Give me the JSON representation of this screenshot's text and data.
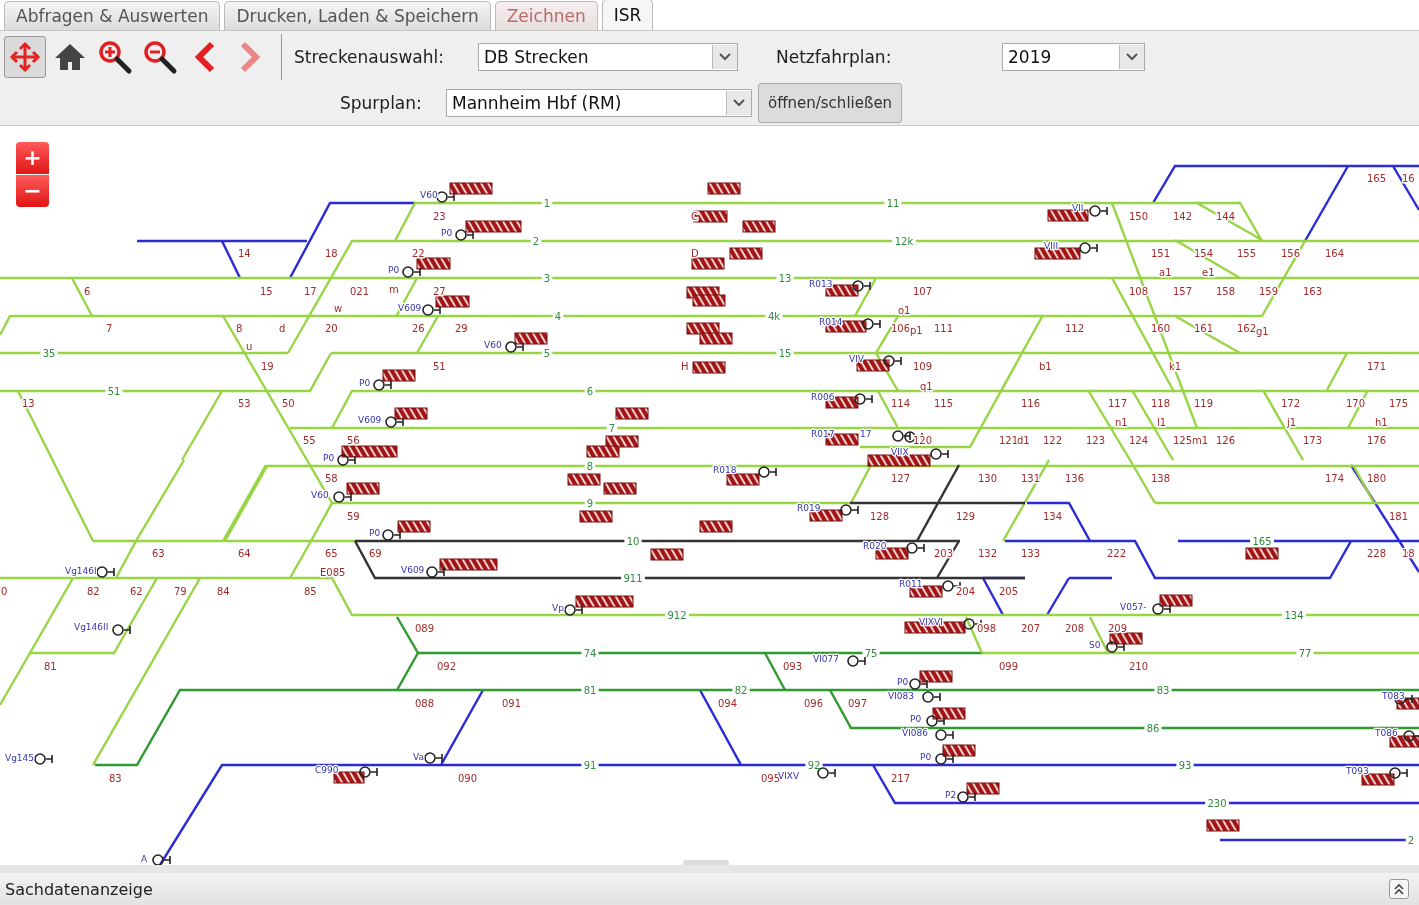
{
  "tabs": [
    {
      "label": "Abfragen & Auswerten",
      "selected": false,
      "disabled": false
    },
    {
      "label": "Drucken, Laden & Speichern",
      "selected": false,
      "disabled": false
    },
    {
      "label": "Zeichnen",
      "selected": false,
      "disabled": true
    },
    {
      "label": "ISR",
      "selected": true,
      "disabled": false
    }
  ],
  "tools": [
    {
      "kind": "pan",
      "selected": true,
      "disabled": false
    },
    {
      "kind": "home",
      "selected": false,
      "disabled": false
    },
    {
      "kind": "zoom_in",
      "selected": false,
      "disabled": false
    },
    {
      "kind": "zoom_out",
      "selected": false,
      "disabled": false
    },
    {
      "kind": "back",
      "selected": false,
      "disabled": false
    },
    {
      "kind": "forward",
      "selected": false,
      "disabled": true
    }
  ],
  "route_select": {
    "label": "Streckenauswahl:",
    "value": "DB Strecken"
  },
  "timetable_select": {
    "label": "Netzfahrplan:",
    "value": "2019"
  },
  "track_plan_select": {
    "label": "Spurplan:",
    "value": "Mannheim Hbf (RM)"
  },
  "toggle_button": "öffnen/schließen",
  "map": {
    "zoom_in": "+",
    "zoom_out": "−",
    "track_numbers": [
      "1",
      "11",
      "2",
      "12k",
      "3",
      "13",
      "4",
      "4k",
      "35",
      "5",
      "15",
      "51",
      "6",
      "7",
      "8",
      "9",
      "10",
      "911",
      "912",
      "74",
      "75",
      "81",
      "82",
      "83",
      "86",
      "91",
      "92",
      "93",
      "230",
      "165",
      "134",
      "77",
      "2"
    ],
    "switch_labels": [
      "14",
      "18",
      "6",
      "15",
      "17",
      "021",
      "m",
      "w",
      "7",
      "8",
      "u",
      "d",
      "20",
      "26",
      "29",
      "19",
      "51",
      "13",
      "53",
      "50",
      "55",
      "56",
      "23",
      "22",
      "27",
      "58",
      "59",
      "63",
      "64",
      "65",
      "69",
      "E085",
      "0",
      "82",
      "62",
      "79",
      "84",
      "85",
      "81",
      "83",
      "089",
      "092",
      "088",
      "091",
      "090",
      "C",
      "D",
      "H",
      "107",
      "o1",
      "106",
      "p1",
      "111",
      "109",
      "q1",
      "114",
      "115",
      "120",
      "127",
      "130",
      "131",
      "136",
      "138",
      "174",
      "180",
      "128",
      "129",
      "134",
      "181",
      "203",
      "132",
      "133",
      "222",
      "228",
      "18",
      "204",
      "205",
      "098",
      "207",
      "208",
      "209",
      "093",
      "099",
      "210",
      "094",
      "096",
      "097",
      "095",
      "217",
      "150",
      "142",
      "144",
      "165",
      "16",
      "151",
      "154",
      "155",
      "156",
      "164",
      "a1",
      "e1",
      "108",
      "157",
      "158",
      "159",
      "163",
      "112",
      "160",
      "161",
      "162",
      "g1",
      "b1",
      "k1",
      "171",
      "116",
      "117",
      "118",
      "119",
      "172",
      "170",
      "175",
      "n1",
      "l1",
      "j1",
      "h1",
      "121",
      "d1",
      "122",
      "123",
      "124",
      "125",
      "m1",
      "126",
      "173",
      "176"
    ],
    "signal_labels": [
      "V60",
      "P0",
      "P0",
      "V609",
      "V60",
      "P0",
      "V609",
      "P0",
      "V60",
      "P0",
      "Vg146I",
      "V609",
      "Vg146II",
      "Vg145",
      "Vp",
      "Va",
      "C990",
      "A",
      "R013",
      "R014",
      "VIV",
      "R006",
      "R017",
      "17",
      "VIIX",
      "R018",
      "R019",
      "R020",
      "R011",
      "VIXVI",
      "VI077",
      "P0",
      "VI083",
      "P0",
      "VI086",
      "P0",
      "VIXV",
      "P2",
      "VII",
      "VIII",
      "V057-",
      "S0",
      "T083",
      "T086",
      "T093"
    ]
  },
  "footer": {
    "title": "Sachdatenanzeige"
  }
}
